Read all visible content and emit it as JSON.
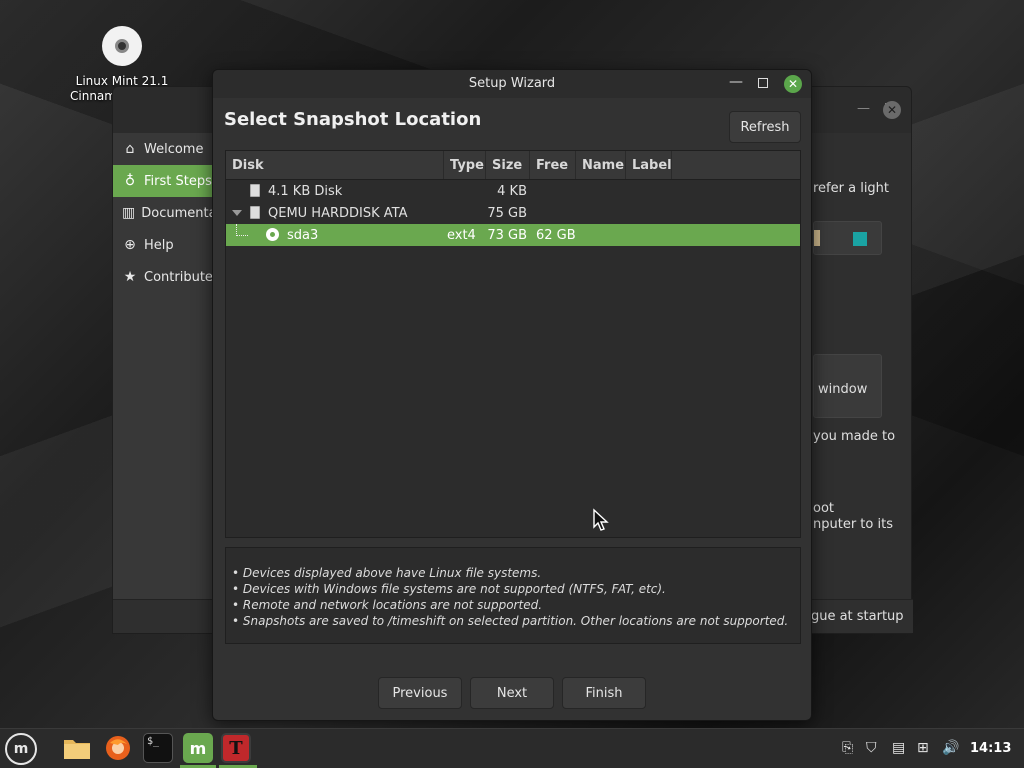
{
  "desktop": {
    "icon_label_line1": "Linux Mint 21.1",
    "icon_label_line2": "Cinnamon",
    "icon": "disc-icon"
  },
  "background_window": {
    "sidebar_items": [
      {
        "label": "Welcome",
        "icon": "home-icon"
      },
      {
        "label": "First Steps",
        "icon": "lightbulb-icon"
      },
      {
        "label": "Documentation",
        "icon": "book-icon"
      },
      {
        "label": "Help",
        "icon": "lifebuoy-icon"
      },
      {
        "label": "Contribute",
        "icon": "star-icon"
      }
    ],
    "text_fragments": {
      "t1": "refer a light",
      "t2": "window",
      "t3": "you made to",
      "t4": "oot",
      "t5": "nputer to its",
      "t6": "ogue at startup"
    }
  },
  "dialog": {
    "window_title": "Setup Wizard",
    "heading": "Select Snapshot Location",
    "refresh_label": "Refresh",
    "columns": [
      "Disk",
      "Type",
      "Size",
      "Free",
      "Name",
      "Label"
    ],
    "rows": [
      {
        "disk": "4.1 KB Disk",
        "type": "",
        "size": "4 KB",
        "free": "",
        "name": "",
        "label": ""
      },
      {
        "disk": "QEMU HARDDISK ATA",
        "type": "",
        "size": "75 GB",
        "free": "",
        "name": "",
        "label": ""
      },
      {
        "disk": "sda3",
        "type": "ext4",
        "size": "73 GB",
        "free": "62 GB",
        "name": "",
        "label": ""
      }
    ],
    "notes": [
      "• Devices displayed above have Linux file systems.",
      "• Devices with Windows file systems are not supported (NTFS, FAT, etc).",
      "• Remote and network locations are not supported.",
      "• Snapshots are saved to /timeshift on selected partition. Other locations are not supported."
    ],
    "buttons": {
      "previous": "Previous",
      "next": "Next",
      "finish": "Finish"
    }
  },
  "taskbar": {
    "clock": "14:13",
    "accent": "#6aa84f"
  }
}
